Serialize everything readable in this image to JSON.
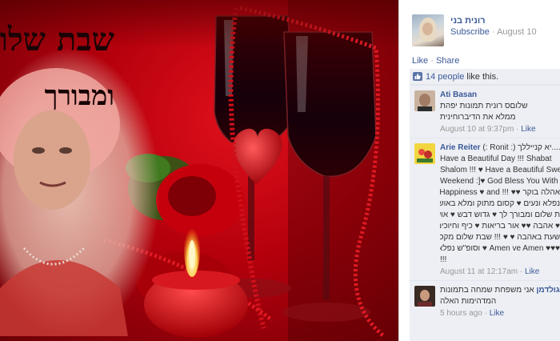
{
  "photo": {
    "caption_line1": "שבת שלום",
    "caption_line2": "ומבורך"
  },
  "post": {
    "author": "רונית בני",
    "subscribe_label": "Subscribe",
    "separator": " · ",
    "date": "August 10",
    "like_label": "Like",
    "share_label": "Share",
    "action_separator": " · "
  },
  "likes": {
    "count_label": "14 people",
    "suffix": " like this."
  },
  "comments": [
    {
      "author": "Ati Basan",
      "lines": [
        "שלוםס רונית תמונות יפהת",
        "ממלא את הדיברוחינית"
      ],
      "time": "August 10 at 9:37pm",
      "like_label": "Like"
    },
    {
      "author": "Arie Reiter",
      "lines": [
        "(: Ronit :) יא קנייללך....",
        "Have a Beautiful Day !!! Shabat",
        "Shalom !!! ♥ Have a Beautiful Sweet",
        "Weekend :]♥ God Bless You With Joy",
        "אהלה בוקר ♥♥ !!! Happiness ♥ and",
        "נפלא ונעים ♥ קסום מתוק ומלא באושר ♥",
        "ת שלום ומבורך לך ♥ גדוש דבש ♥ אושר ♥",
        "♥ אהבה ♥♥ אור בריאות ♥ כיף וחיוכים",
        "שעת באהבה ♥ ♥ !!! שבת שלום מקסימה",
        "♥♥♥ Amen ve Amen ♥ וסופ\"ש נפלא",
        "!!!"
      ],
      "time": "August 11 at 12:17am",
      "like_label": "Like"
    },
    {
      "author": "לה גולדמן",
      "lines": [
        "אני משפחת שמחה בתמונות",
        "המדהימות האלה"
      ],
      "time": "5 hours ago",
      "like_label": "Like"
    }
  ],
  "colors": {
    "link": "#3b5998",
    "ufi_background": "#edeff4",
    "photo_red": "#c4000f"
  },
  "icons": [
    "thumbs-up-icon"
  ]
}
